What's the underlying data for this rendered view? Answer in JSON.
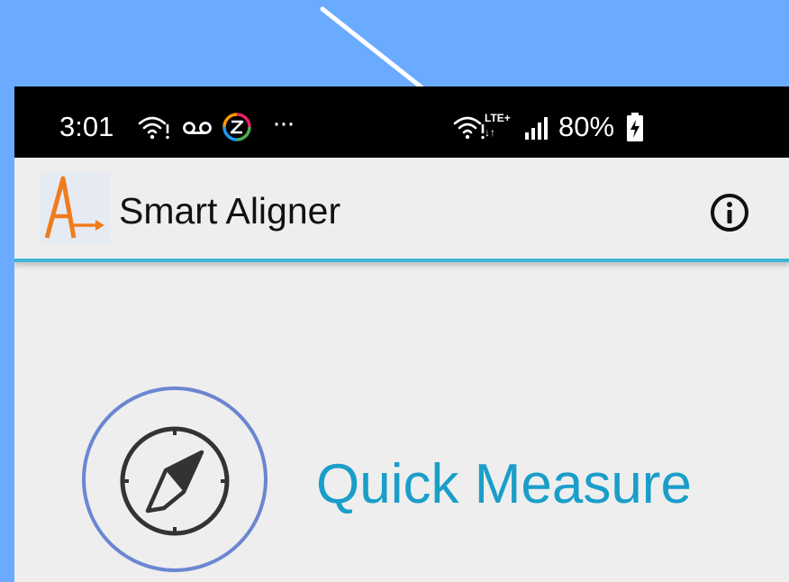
{
  "status_bar": {
    "time": "3:01",
    "more": "···",
    "network_type": "LTE+",
    "network_arrows": "↓↑",
    "battery_percent": "80%",
    "left_icons": [
      "wifi-icon",
      "voicemail-icon",
      "z-app-icon"
    ],
    "right_icons": [
      "wifi-icon",
      "signal-icon",
      "battery-charging-icon"
    ]
  },
  "app_bar": {
    "title": "Smart Aligner",
    "logo_icon": "smart-aligner-logo",
    "info_icon": "info-icon"
  },
  "menu": {
    "items": [
      {
        "label": "Quick Measure",
        "icon": "compass-icon"
      }
    ]
  },
  "colors": {
    "background": "#6aabff",
    "status_bar": "#000000",
    "app_bar": "#eeeeee",
    "accent_line": "#3cb6d4",
    "menu_text": "#1a9ec9",
    "circle_outline": "#6b86d1",
    "logo_orange": "#f07c1e"
  }
}
